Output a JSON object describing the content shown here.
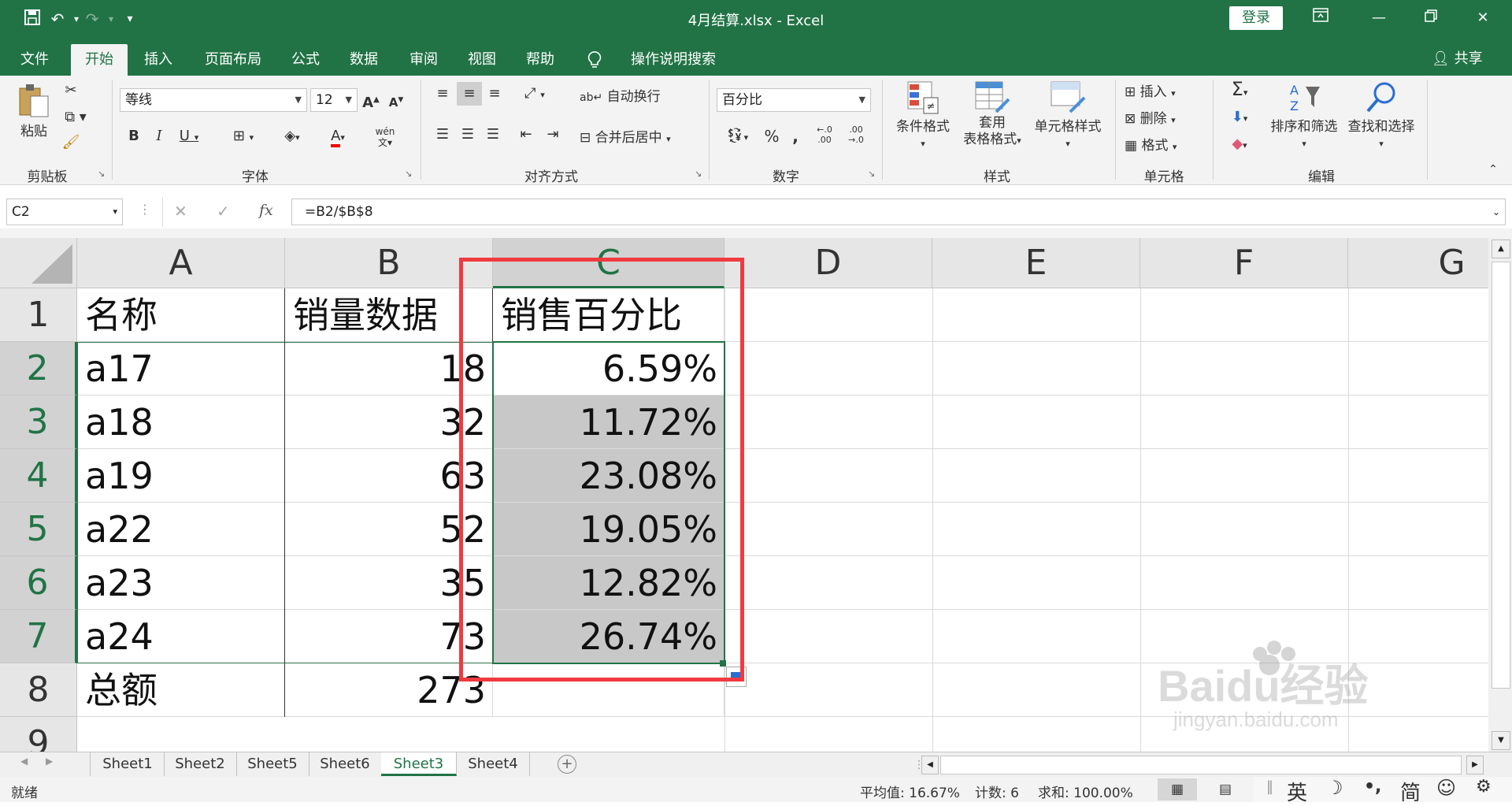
{
  "window": {
    "title": "4月结算.xlsx  -  Excel",
    "login": "登录",
    "share": "共享"
  },
  "tabs": [
    "文件",
    "开始",
    "插入",
    "页面布局",
    "公式",
    "数据",
    "审阅",
    "视图",
    "帮助"
  ],
  "tell_me": "操作说明搜索",
  "ribbon": {
    "clipboard": {
      "label": "剪贴板",
      "paste": "粘贴"
    },
    "font": {
      "label": "字体",
      "name": "等线",
      "size": "12",
      "phonetic": "wén"
    },
    "alignment": {
      "label": "对齐方式",
      "wrap": "自动换行",
      "merge": "合并后居中"
    },
    "number": {
      "label": "数字",
      "format": "百分比",
      "percent": "%",
      "comma": ","
    },
    "styles": {
      "label": "样式",
      "conditional": "条件格式",
      "table_line1": "套用",
      "table_line2": "表格格式",
      "cell_styles": "单元格样式"
    },
    "cells": {
      "label": "单元格",
      "insert": "插入",
      "delete": "删除",
      "format": "格式"
    },
    "editing": {
      "label": "编辑",
      "sort": "排序和筛选",
      "find": "查找和选择"
    }
  },
  "formula_bar": {
    "namebox": "C2",
    "fx": "fx",
    "formula": "=B2/$B$8"
  },
  "columns": [
    "A",
    "B",
    "C",
    "D",
    "E",
    "F",
    "G"
  ],
  "rows": [
    {
      "n": "1",
      "a": "名称",
      "b": "销量数据",
      "c": "销售百分比"
    },
    {
      "n": "2",
      "a": "a17",
      "b": "18",
      "c": "6.59%"
    },
    {
      "n": "3",
      "a": "a18",
      "b": "32",
      "c": "11.72%"
    },
    {
      "n": "4",
      "a": "a19",
      "b": "63",
      "c": "23.08%"
    },
    {
      "n": "5",
      "a": "a22",
      "b": "52",
      "c": "19.05%"
    },
    {
      "n": "6",
      "a": "a23",
      "b": "35",
      "c": "12.82%"
    },
    {
      "n": "7",
      "a": "a24",
      "b": "73",
      "c": "26.74%"
    },
    {
      "n": "8",
      "a": "总额",
      "b": "273",
      "c": ""
    },
    {
      "n": "9",
      "a": "",
      "b": "",
      "c": ""
    }
  ],
  "sheets": [
    "Sheet1",
    "Sheet2",
    "Sheet5",
    "Sheet6",
    "Sheet3",
    "Sheet4"
  ],
  "active_sheet": "Sheet3",
  "status": {
    "ready": "就绪",
    "average": "平均值: 16.67%",
    "count": "计数: 6",
    "sum": "求和: 100.00%",
    "ime": [
      "英",
      "简"
    ]
  },
  "watermark": "Baidu经验 jingyan.baidu.com",
  "colors": {
    "accent": "#217346",
    "highlight": "#ef3b3f",
    "selection_fill": "#c8c8c8"
  }
}
